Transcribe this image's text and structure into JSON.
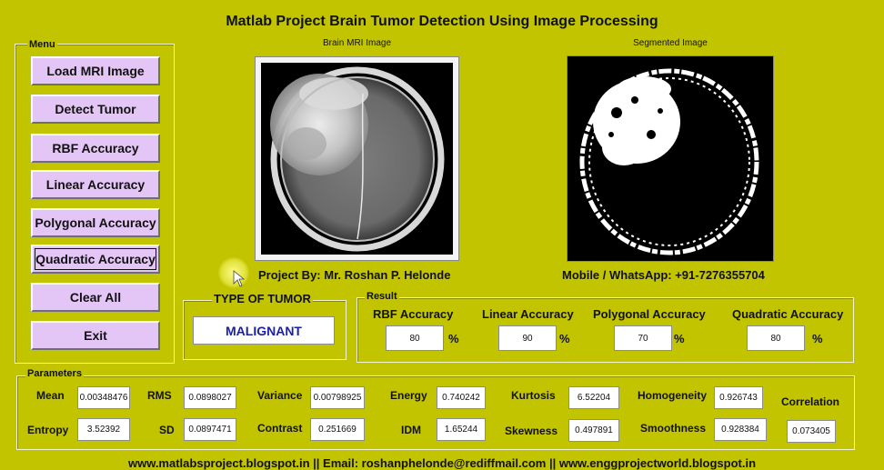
{
  "window": {
    "title": "Matlab Project Brain Tumor Detection Using Image Processing"
  },
  "menu": {
    "title": "Menu",
    "buttons": [
      "Load MRI Image",
      "Detect Tumor",
      "RBF Accuracy",
      "Linear Accuracy",
      "Polygonal Accuracy",
      "Quadratic Accuracy",
      "Clear All",
      "Exit"
    ]
  },
  "images": {
    "mri_caption": "Brain MRI Image",
    "segmented_caption": "Segmented Image"
  },
  "credits": {
    "author": "Project By: Mr. Roshan P. Helonde",
    "mobile": "Mobile / WhatsApp: +91-7276355704"
  },
  "tumor": {
    "label": "TYPE OF TUMOR",
    "value": "MALIGNANT"
  },
  "result": {
    "title": "Result",
    "items": [
      {
        "label": "RBF Accuracy",
        "value": "80",
        "unit": "%"
      },
      {
        "label": "Linear Accuracy",
        "value": "90",
        "unit": "%"
      },
      {
        "label": "Polygonal Accuracy",
        "value": "70",
        "unit": "%"
      },
      {
        "label": "Quadratic Accuracy",
        "value": "80",
        "unit": "%"
      }
    ]
  },
  "parameters": {
    "title": "Parameters",
    "mean": {
      "label": "Mean",
      "value": "0.00348476"
    },
    "rms": {
      "label": "RMS",
      "value": "0.0898027"
    },
    "variance": {
      "label": "Variance",
      "value": "0.00798925"
    },
    "energy": {
      "label": "Energy",
      "value": "0.740242"
    },
    "kurtosis": {
      "label": "Kurtosis",
      "value": "6.52204"
    },
    "homogeneity": {
      "label": "Homogeneity",
      "value": "0.926743"
    },
    "correlation": {
      "label": "Correlation",
      "value": "0.073405"
    },
    "entropy": {
      "label": "Entropy",
      "value": "3.52392"
    },
    "sd": {
      "label": "SD",
      "value": "0.0897471"
    },
    "contrast": {
      "label": "Contrast",
      "value": "0.251669"
    },
    "idm": {
      "label": "IDM",
      "value": "1.65244"
    },
    "skewness": {
      "label": "Skewness",
      "value": "0.497891"
    },
    "smoothness": {
      "label": "Smoothness",
      "value": "0.928384"
    }
  },
  "footer": {
    "text": "www.matlabsproject.blogspot.in    ||    Email: roshanphelonde@rediffmail.com    ||    www.enggprojectworld.blogspot.in"
  }
}
